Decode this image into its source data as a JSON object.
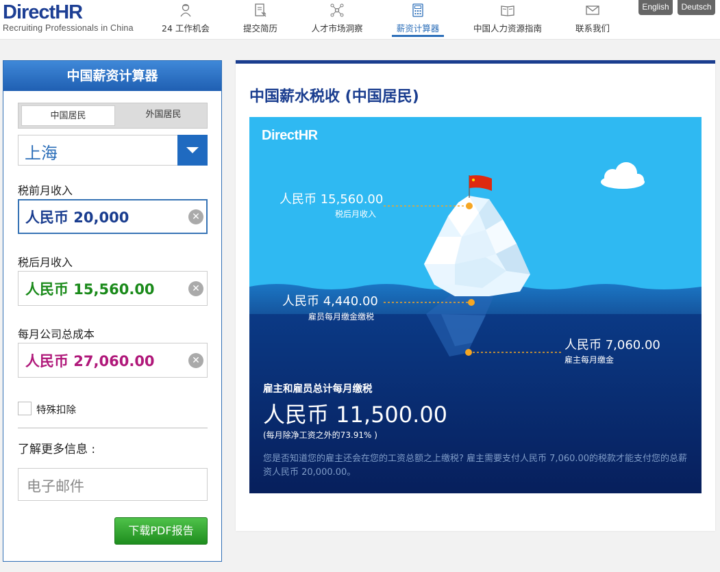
{
  "header": {
    "logo_main": "DirectHR",
    "logo_tagline": "Recruiting Professionals in China",
    "nav": [
      {
        "label": "24 工作机会",
        "icon": "job-icon"
      },
      {
        "label": "提交简历",
        "icon": "resume-icon"
      },
      {
        "label": "人才市场洞察",
        "icon": "network-icon"
      },
      {
        "label": "薪资计算器",
        "icon": "calculator-icon",
        "active": true
      },
      {
        "label": "中国人力资源指南",
        "icon": "book-icon"
      },
      {
        "label": "联系我们",
        "icon": "mail-icon"
      }
    ],
    "languages": [
      "English",
      "Deutsch"
    ]
  },
  "calculator": {
    "title": "中国薪资计算器",
    "residency_options": [
      "中国居民",
      "外国居民"
    ],
    "city": "上海",
    "gross_label": "税前月收入",
    "gross_value": "人民币 20,000",
    "net_label": "税后月收入",
    "net_value": "人民币 15,560.00",
    "cost_label": "每月公司总成本",
    "cost_value": "人民币 27,060.00",
    "special_deduction_label": "特殊扣除",
    "more_info_label": "了解更多信息 :",
    "email_placeholder": "电子邮件",
    "pdf_button": "下载PDF报告"
  },
  "result": {
    "title": "中国薪水税收 (中国居民)",
    "brand": "DirectHR",
    "net_amount": "人民币 15,560.00",
    "net_caption": "税后月收入",
    "employee_amount": "人民币 4,440.00",
    "employee_caption": "雇员每月缴金缴税",
    "employer_amount": "人民币 7,060.00",
    "employer_caption": "雇主每月缴金",
    "total_caption": "雇主和雇员总计每月缴税",
    "total_amount": "人民币 11,500.00",
    "total_percent": "(每月除净工资之外的73.91% )",
    "note": "您是否知道您的雇主还会在您的工资总额之上缴税? 雇主需要支付人民币 7,060.00的税款才能支付您的总薪资人民币 20,000.00。"
  },
  "colors": {
    "brand_blue": "#1a3d8f",
    "net_green": "#1a8a1a",
    "cost_magenta": "#b0187a",
    "gross_blue": "#1a3d8f",
    "sky": "#29b6f0",
    "deep_sea": "#0a2c70"
  }
}
